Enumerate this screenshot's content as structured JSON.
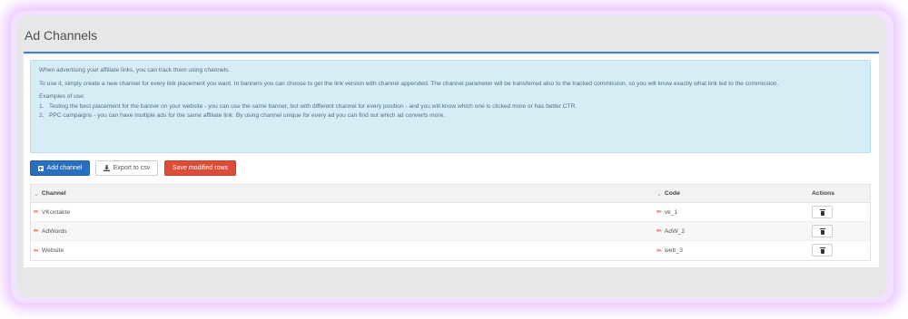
{
  "page": {
    "title": "Ad Channels"
  },
  "info": {
    "intro": "When advertising your affiliate links, you can track them using channels.",
    "usage": "To use it, simply create a new channel for every link placement you want. In banners you can choose to get the link version with channel appended. The channel parameter will be transferred also to the tracked commission, so you will know exactly what link led to the commission.",
    "examples_heading": "Examples of use:",
    "examples": [
      {
        "num": "1.",
        "text": "Testing the best placement for the banner on your website - you can use the same banner, but with different channel for every position - and you will know which one is clicked more or has better CTR."
      },
      {
        "num": "2.",
        "text": "PPC campaigns - you can have multiple ads for the same affiliate link. By using channel unique for every ad you can find out which ad converts more."
      }
    ]
  },
  "toolbar": {
    "add_label": "Add channel",
    "export_label": "Export to csv",
    "save_label": "Save modified rows"
  },
  "table": {
    "headers": {
      "channel": "Channel",
      "code": "Code",
      "actions": "Actions"
    },
    "rows": [
      {
        "channel": "VKontakte",
        "code": "vk_1"
      },
      {
        "channel": "AdWords",
        "code": "AdW_2"
      },
      {
        "channel": "Website",
        "code": "web_3"
      }
    ]
  },
  "colors": {
    "accent": "#2a6fbf",
    "danger": "#dd4b39",
    "info_bg": "#d6edf6"
  },
  "icons": [
    "plus-icon",
    "download-icon",
    "sort-chevron-icon",
    "pencil-icon",
    "trash-icon"
  ]
}
